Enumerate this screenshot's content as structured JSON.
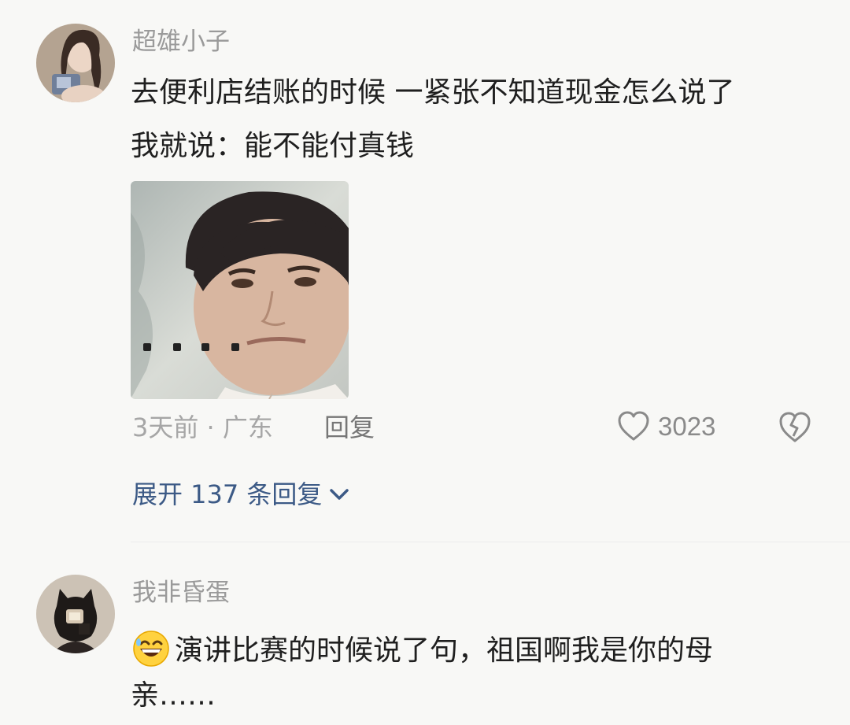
{
  "comments": [
    {
      "username": "超雄小子",
      "text_line1": "去便利店结账的时候 一紧张不知道现金怎么说了",
      "text_line2": "我就说：能不能付真钱",
      "meta": "3天前 · 广东",
      "reply_label": "回复",
      "likes": "3023",
      "expand_label": "展开 137 条回复"
    },
    {
      "username": "我非昏蛋",
      "text_line1": "演讲比赛的时候说了句，祖国啊我是你的母",
      "text_line2": "亲……"
    }
  ],
  "colors": {
    "background": "#f8f8f6",
    "link_blue": "#3c5a86",
    "text": "#1f1f1f",
    "muted": "#9a9a9a"
  },
  "icons": [
    "heart-outline-icon",
    "broken-heart-icon",
    "chevron-down-icon",
    "grinning-emoji-icon"
  ]
}
